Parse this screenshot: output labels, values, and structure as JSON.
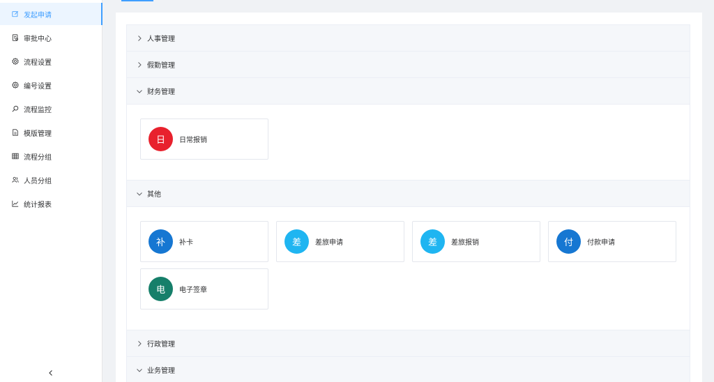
{
  "sidebar": {
    "items": [
      {
        "label": "发起申请",
        "icon": "edit-icon",
        "active": true
      },
      {
        "label": "审批中心",
        "icon": "audit-icon",
        "active": false
      },
      {
        "label": "流程设置",
        "icon": "gear-icon",
        "active": false
      },
      {
        "label": "编号设置",
        "icon": "gear-icon",
        "active": false
      },
      {
        "label": "流程监控",
        "icon": "search-icon",
        "active": false
      },
      {
        "label": "模版管理",
        "icon": "document-icon",
        "active": false
      },
      {
        "label": "流程分组",
        "icon": "grid-icon",
        "active": false
      },
      {
        "label": "人员分组",
        "icon": "users-icon",
        "active": false
      },
      {
        "label": "统计报表",
        "icon": "line-chart-icon",
        "active": false
      }
    ],
    "collapse_icon": "chevron-left-icon"
  },
  "groups": [
    {
      "title": "人事管理",
      "expanded": false
    },
    {
      "title": "假勤管理",
      "expanded": false
    },
    {
      "title": "财务管理",
      "expanded": true,
      "forms": [
        {
          "avatar_char": "日",
          "label": "日常报销",
          "color": "#e8212d"
        }
      ]
    },
    {
      "title": "其他",
      "expanded": true,
      "forms": [
        {
          "avatar_char": "补",
          "label": "补卡",
          "color": "#1677d2"
        },
        {
          "avatar_char": "差",
          "label": "差旅申请",
          "color": "#1fb5f1"
        },
        {
          "avatar_char": "差",
          "label": "差旅报销",
          "color": "#1fb5f1"
        },
        {
          "avatar_char": "付",
          "label": "付款申请",
          "color": "#1677d2"
        },
        {
          "avatar_char": "电",
          "label": "电子签章",
          "color": "#167f6a"
        }
      ]
    },
    {
      "title": "行政管理",
      "expanded": false
    },
    {
      "title": "业务管理",
      "expanded": false
    }
  ],
  "colors": {
    "accent": "#409eff",
    "active_bg": "#ecf5ff",
    "page_bg": "#f0f2f5",
    "header_bg": "#f5f7fa"
  }
}
